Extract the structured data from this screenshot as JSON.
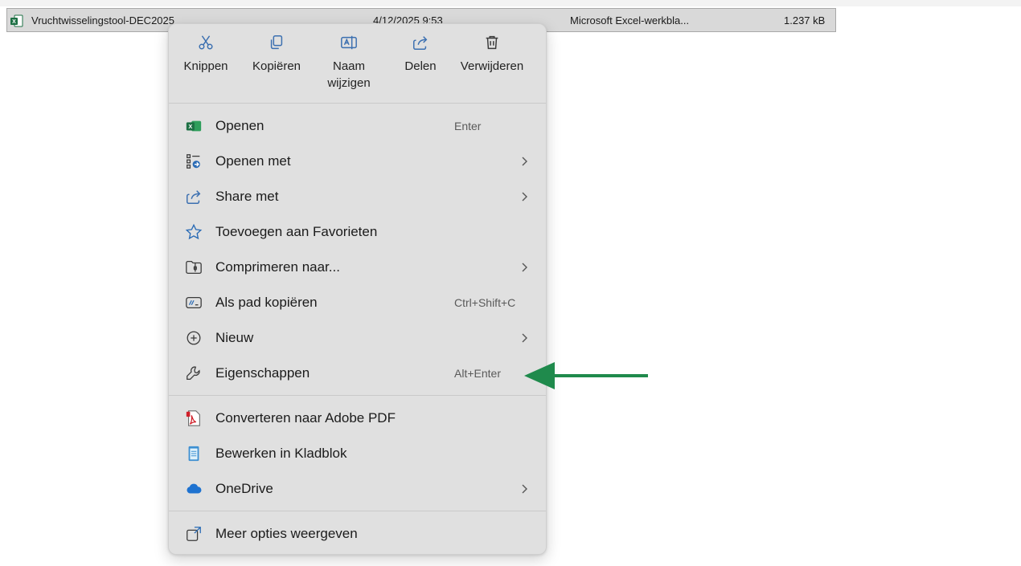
{
  "file_row": {
    "name": "Vruchtwisselingstool-DEC2025",
    "date": "4/12/2025 9:53",
    "type": "Microsoft Excel-werkbla...",
    "size": "1.237 kB"
  },
  "quick_actions": {
    "cut": "Knippen",
    "copy": "Kopiëren",
    "rename": "Naam wijzigen",
    "share": "Delen",
    "delete": "Verwijderen"
  },
  "menu": {
    "open": "Openen",
    "open_shortcut": "Enter",
    "open_with": "Openen met",
    "share_with": "Share met",
    "add_favorites": "Toevoegen aan Favorieten",
    "compress": "Comprimeren naar...",
    "copy_path": "Als pad kopiëren",
    "copy_path_shortcut": "Ctrl+Shift+C",
    "new": "Nieuw",
    "properties": "Eigenschappen",
    "properties_shortcut": "Alt+Enter",
    "convert_pdf": "Converteren naar Adobe PDF",
    "edit_notepad": "Bewerken in Kladblok",
    "onedrive": "OneDrive",
    "more_options": "Meer opties weergeven"
  },
  "icons": {
    "excel": "excel-icon",
    "cut": "scissors-icon",
    "copy": "copy-icon",
    "rename": "rename-icon",
    "share": "share-icon",
    "delete": "trash-icon",
    "open_with": "apps-icon",
    "share_with": "share-icon",
    "favorites": "star-icon",
    "compress": "zip-folder-icon",
    "copy_path": "path-icon",
    "new": "plus-circle-icon",
    "properties": "wrench-icon",
    "pdf": "pdf-icon",
    "notepad": "notepad-icon",
    "onedrive": "cloud-icon",
    "more": "expand-icon"
  },
  "colors": {
    "selection_bg": "#d9d9d9",
    "menu_bg": "#e0e0e0",
    "arrow": "#1f8a4c",
    "excel_green": "#1d7044",
    "accent_blue": "#2a6bb5",
    "onedrive_blue": "#1e72d0"
  }
}
